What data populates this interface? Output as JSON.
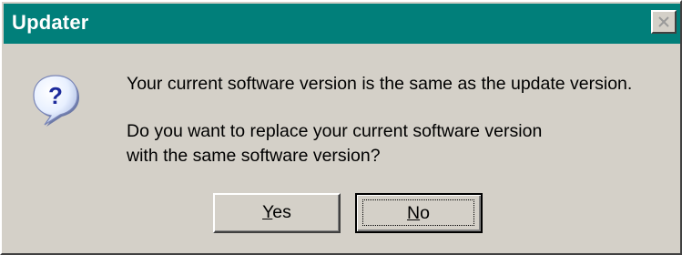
{
  "window": {
    "title": "Updater",
    "close_icon": "close-icon",
    "titlebar_color": "#017f7a",
    "face_color": "#d4d0c8"
  },
  "dialog": {
    "icon": "question-icon",
    "message_line1": "Your current software version is the same as the update version.",
    "message_line2": "Do you want to replace your current software version\nwith the same software version?"
  },
  "buttons": {
    "yes": {
      "mnemonic": "Y",
      "rest": "es"
    },
    "no": {
      "mnemonic": "N",
      "rest": "o"
    }
  }
}
